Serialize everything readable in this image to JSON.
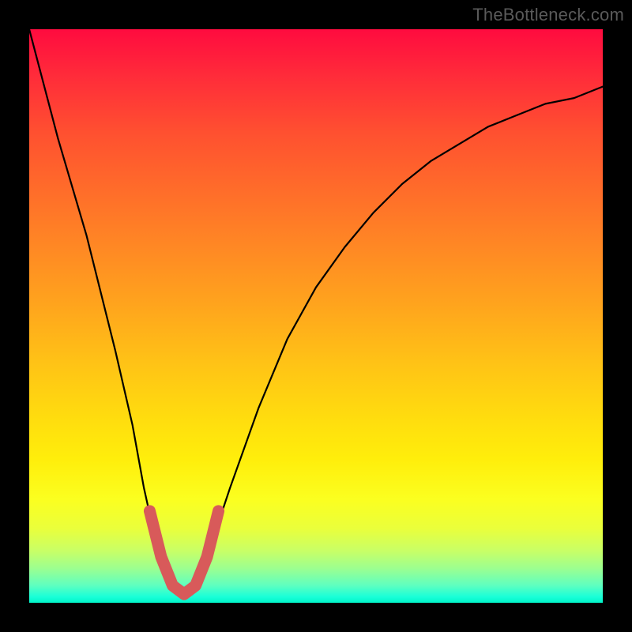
{
  "watermark": {
    "text": "TheBottleneck.com"
  },
  "colors": {
    "background": "#000000",
    "curve_stroke": "#000000",
    "highlight_stroke": "#d85a5a"
  },
  "chart_data": {
    "type": "line",
    "title": "",
    "xlabel": "",
    "ylabel": "",
    "xlim": [
      0,
      100
    ],
    "ylim": [
      0,
      100
    ],
    "grid": false,
    "legend": false,
    "series": [
      {
        "name": "bottleneck_curve",
        "x": [
          0,
          5,
          10,
          15,
          18,
          20,
          22,
          24,
          26,
          27,
          28,
          30,
          32,
          35,
          40,
          45,
          50,
          55,
          60,
          65,
          70,
          75,
          80,
          85,
          90,
          95,
          100
        ],
        "values": [
          100,
          81,
          64,
          44,
          31,
          20,
          11,
          5,
          2,
          1.5,
          2,
          5,
          11,
          20,
          34,
          46,
          55,
          62,
          68,
          73,
          77,
          80,
          83,
          85,
          87,
          88,
          90
        ]
      },
      {
        "name": "highlight_bottom_u",
        "x": [
          21,
          23,
          25,
          27,
          29,
          31,
          33
        ],
        "values": [
          16,
          8,
          3,
          1.5,
          3,
          8,
          16
        ]
      }
    ],
    "annotations": []
  }
}
